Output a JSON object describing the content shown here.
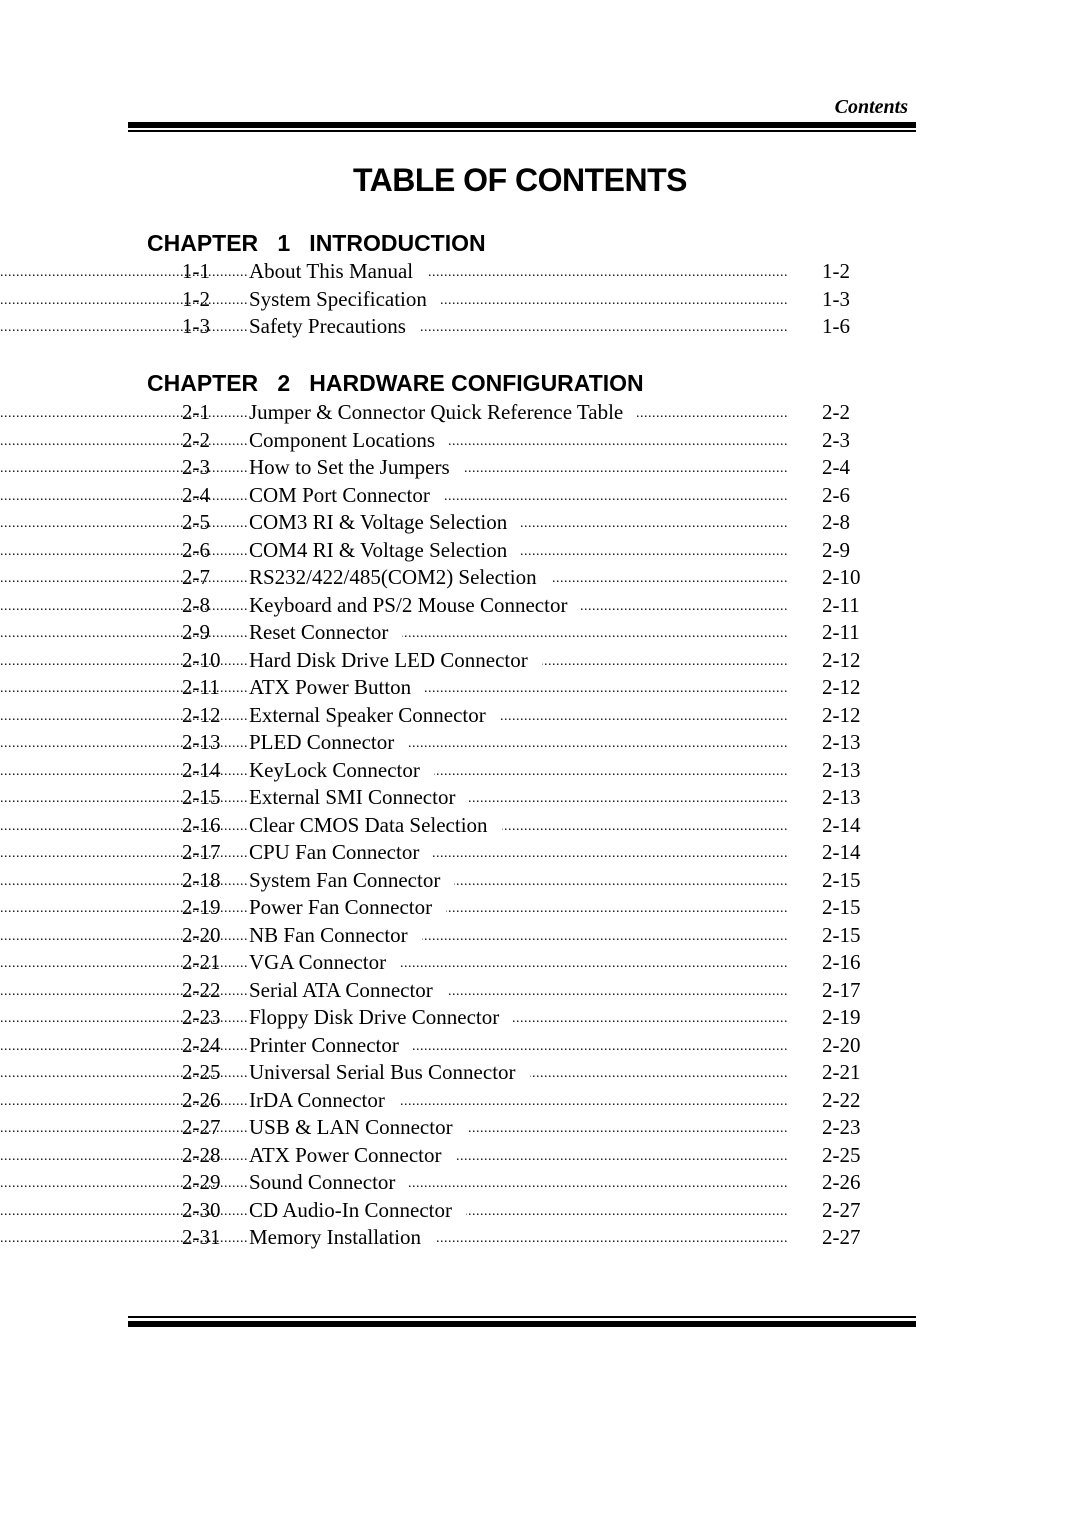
{
  "header": {
    "running_head": "Contents",
    "title": "TABLE OF CONTENTS"
  },
  "chapters": [
    {
      "heading": "CHAPTER   1   INTRODUCTION",
      "entries": [
        {
          "num": "1-1",
          "title": "About This Manual",
          "page": "1-2"
        },
        {
          "num": "1-2",
          "title": "System Specification",
          "page": "1-3"
        },
        {
          "num": "1-3",
          "title": "Safety Precautions",
          "page": "1-6"
        }
      ]
    },
    {
      "heading": "CHAPTER   2   HARDWARE CONFIGURATION",
      "entries": [
        {
          "num": "2-1",
          "title": "Jumper & Connector Quick Reference Table",
          "page": "2-2"
        },
        {
          "num": "2-2",
          "title": "Component Locations",
          "page": "2-3"
        },
        {
          "num": "2-3",
          "title": "How to Set the Jumpers",
          "page": "2-4"
        },
        {
          "num": "2-4",
          "title": "COM Port Connector",
          "page": "2-6"
        },
        {
          "num": "2-5",
          "title": "COM3 RI & Voltage Selection",
          "page": "2-8"
        },
        {
          "num": "2-6",
          "title": "COM4 RI & Voltage Selection",
          "page": "2-9"
        },
        {
          "num": "2-7",
          "title": "RS232/422/485(COM2) Selection",
          "page": "2-10"
        },
        {
          "num": "2-8",
          "title": "Keyboard and PS/2 Mouse Connector",
          "page": "2-11"
        },
        {
          "num": "2-9",
          "title": "Reset Connector",
          "page": "2-11"
        },
        {
          "num": "2-10",
          "title": "Hard Disk Drive LED Connector",
          "page": "2-12"
        },
        {
          "num": "2-11",
          "title": "ATX Power Button",
          "page": "2-12"
        },
        {
          "num": "2-12",
          "title": "External Speaker Connector",
          "page": "2-12"
        },
        {
          "num": "2-13",
          "title": "PLED Connector",
          "page": "2-13"
        },
        {
          "num": "2-14",
          "title": "KeyLock Connector",
          "page": "2-13"
        },
        {
          "num": "2-15",
          "title": "External SMI Connector",
          "page": "2-13"
        },
        {
          "num": "2-16",
          "title": "Clear CMOS Data Selection",
          "page": "2-14"
        },
        {
          "num": "2-17",
          "title": "CPU Fan Connector",
          "page": "2-14"
        },
        {
          "num": "2-18",
          "title": "System Fan Connector",
          "page": "2-15"
        },
        {
          "num": "2-19",
          "title": "Power Fan Connector",
          "page": "2-15"
        },
        {
          "num": "2-20",
          "title": "NB Fan Connector",
          "page": "2-15"
        },
        {
          "num": "2-21",
          "title": "VGA Connector",
          "page": "2-16"
        },
        {
          "num": "2-22",
          "title": "Serial ATA Connector",
          "page": "2-17"
        },
        {
          "num": "2-23",
          "title": "Floppy Disk Drive Connector",
          "page": "2-19"
        },
        {
          "num": "2-24",
          "title": "Printer Connector",
          "page": "2-20"
        },
        {
          "num": "2-25",
          "title": "Universal Serial Bus Connector",
          "page": "2-21"
        },
        {
          "num": "2-26",
          "title": "IrDA Connector",
          "page": "2-22"
        },
        {
          "num": "2-27",
          "title": "USB & LAN Connector",
          "page": "2-23"
        },
        {
          "num": "2-28",
          "title": "ATX Power Connector",
          "page": "2-25"
        },
        {
          "num": "2-29",
          "title": "Sound Connector",
          "page": "2-26"
        },
        {
          "num": "2-30",
          "title": "CD Audio-In Connector",
          "page": "2-27"
        },
        {
          "num": "2-31",
          "title": "Memory Installation",
          "page": "2-27"
        }
      ]
    }
  ]
}
